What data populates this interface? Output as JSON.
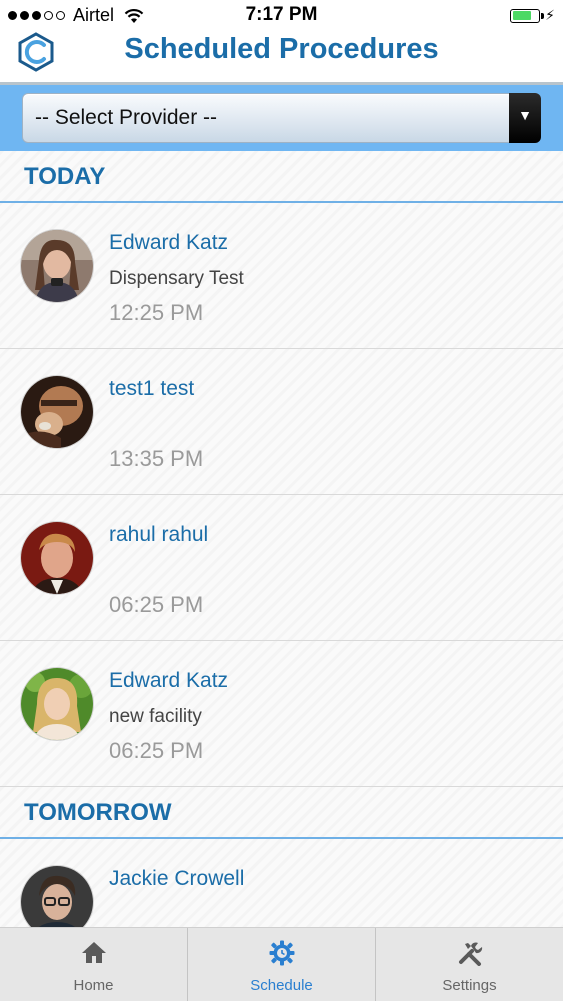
{
  "status_bar": {
    "carrier": "Airtel",
    "time": "7:17 PM",
    "signal_dots_filled": 3,
    "signal_dots_total": 5,
    "battery_level": 0.75
  },
  "header": {
    "title": "Scheduled Procedures",
    "accent_color": "#1b6da8"
  },
  "provider_select": {
    "selected": "-- Select Provider --",
    "arrow": "▼"
  },
  "sections": {
    "today": {
      "label": "TODAY",
      "appointments": [
        {
          "name": "Edward Katz",
          "facility": "Dispensary Test",
          "time": "12:25 PM"
        },
        {
          "name": "test1 test",
          "facility": "",
          "time": "13:35 PM"
        },
        {
          "name": "rahul rahul",
          "facility": "",
          "time": "06:25 PM"
        },
        {
          "name": "Edward Katz",
          "facility": "new facility",
          "time": "06:25 PM"
        }
      ]
    },
    "tomorrow": {
      "label": "TOMORROW",
      "appointments": [
        {
          "name": "Jackie Crowell",
          "facility": "",
          "time": ""
        }
      ]
    }
  },
  "tab_bar": {
    "tabs": [
      {
        "label": "Home",
        "icon": "home-icon"
      },
      {
        "label": "Schedule",
        "icon": "schedule-gear-icon"
      },
      {
        "label": "Settings",
        "icon": "tools-icon"
      }
    ],
    "active_tab": "Schedule",
    "active_color": "#2a7fd0"
  }
}
